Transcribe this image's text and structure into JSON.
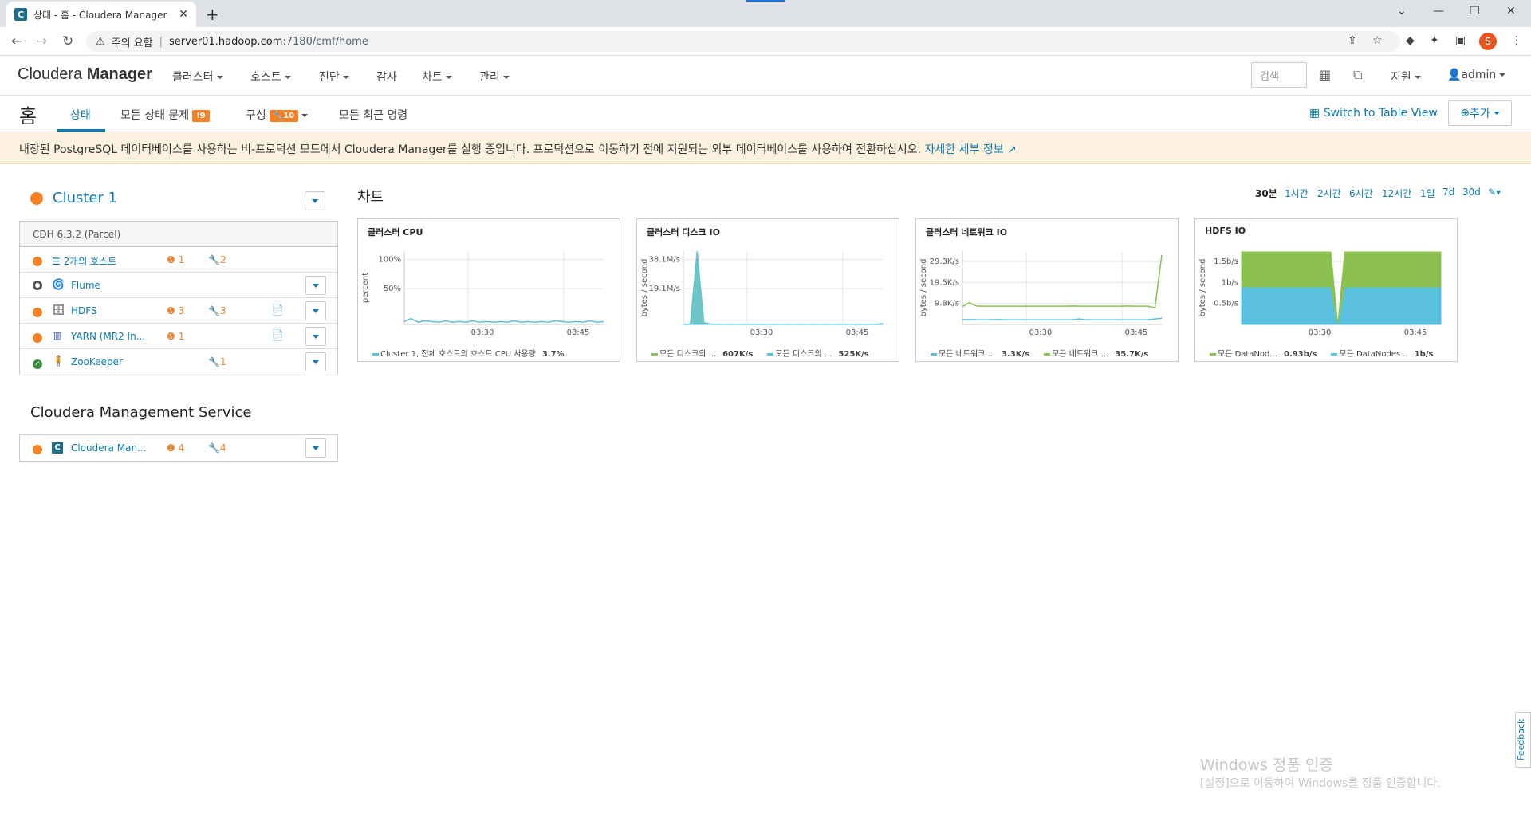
{
  "browser": {
    "tab_title": "상태 - 홈 - Cloudera Manager",
    "security_label": "주의 요함",
    "url_host": "server01.hadoop.com",
    "url_path": ":7180/cmf/home",
    "profile_initial": "S"
  },
  "header": {
    "logo_light": "Cloudera ",
    "logo_bold": "Manager",
    "menu": [
      "클러스터",
      "호스트",
      "진단",
      "감사",
      "차트",
      "관리"
    ],
    "search_placeholder": "검색",
    "support": "지원",
    "user": "admin"
  },
  "subnav": {
    "page_title": "홈",
    "tabs": {
      "status": "상태",
      "all_issues": "모든 상태 문제",
      "all_issues_count": "9",
      "config": "구성",
      "config_count": "10",
      "recent_commands": "모든 최근 명령"
    },
    "table_view": "Switch to Table View",
    "add": "추가"
  },
  "banner": {
    "text": "내장된 PostgreSQL 데이터베이스를 사용하는 비-프로덕션 모드에서 Cloudera Manager를 실행 중입니다. 프로덕션으로 이동하기 전에 지원되는 외부 데이터베이스를 사용하여 전환하십시오.",
    "link": "자세한 세부 정보"
  },
  "cluster": {
    "name": "Cluster 1",
    "version": "CDH 6.3.2 (Parcel)",
    "rows": [
      {
        "name": "2개의 호스트",
        "alerts": "1",
        "config": "2"
      },
      {
        "name": "Flume",
        "alerts": "",
        "config": ""
      },
      {
        "name": "HDFS",
        "alerts": "3",
        "config": "3"
      },
      {
        "name": "YARN (MR2 In...",
        "alerts": "1",
        "config": ""
      },
      {
        "name": "ZooKeeper",
        "alerts": "",
        "config": "1"
      }
    ]
  },
  "mgmt": {
    "title": "Cloudera Management Service",
    "row": {
      "name": "Cloudera Man...",
      "alerts": "4",
      "config": "4"
    }
  },
  "charts": {
    "title": "차트",
    "ranges": [
      "30분",
      "1시간",
      "2시간",
      "6시간",
      "12시간",
      "1일",
      "7d",
      "30d"
    ],
    "active_range": "30분"
  },
  "chart_data": [
    {
      "type": "line",
      "title": "클러스터 CPU",
      "ylabel": "percent",
      "yticks": [
        "100%",
        "50%"
      ],
      "xticks": [
        "03:30",
        "03:45"
      ],
      "ylim": [
        0,
        100
      ],
      "series": [
        {
          "name": "Cluster 1, 전체 호스트의 호스트 CPU 사용량",
          "last": "3.7%",
          "color": "#5bc0de",
          "values": [
            4,
            8,
            3,
            5,
            4,
            3,
            5,
            3,
            4,
            3,
            5,
            3,
            4,
            3,
            4,
            3,
            5,
            3,
            4,
            3,
            4,
            3,
            5,
            4,
            3,
            4,
            3,
            5,
            3,
            4
          ]
        }
      ]
    },
    {
      "type": "area",
      "title": "클러스터 디스크 IO",
      "ylabel": "bytes / second",
      "yticks": [
        "38.1M/s",
        "19.1M/s"
      ],
      "xticks": [
        "03:30",
        "03:45"
      ],
      "ylim": [
        0,
        57
      ],
      "series": [
        {
          "name": "모든 디스크의 ...",
          "last": "607K/s",
          "color": "#8cc152",
          "values": [
            0.3,
            0.5,
            57,
            1.5,
            0.5,
            0.4,
            0.3,
            0.4,
            0.3,
            0.4,
            0.3,
            0.4,
            0.3,
            0.4,
            0.3,
            0.4,
            0.3,
            0.4,
            0.3,
            0.4,
            0.3,
            0.4,
            0.3,
            0.4,
            0.3,
            0.4,
            0.3,
            0.4,
            0.3,
            0.6
          ]
        },
        {
          "name": "모든 디스크의 ...",
          "last": "525K/s",
          "color": "#5bc0de",
          "values": [
            0.2,
            0.3,
            57,
            1.2,
            0.3,
            0.2,
            0.2,
            0.2,
            0.2,
            0.2,
            0.2,
            0.2,
            0.2,
            0.2,
            0.2,
            0.2,
            0.2,
            0.2,
            0.2,
            0.2,
            0.2,
            0.2,
            0.2,
            0.2,
            0.2,
            0.2,
            0.2,
            0.2,
            0.2,
            0.5
          ]
        }
      ]
    },
    {
      "type": "line",
      "title": "클러스터 네트워크 IO",
      "ylabel": "bytes / second",
      "yticks": [
        "29.3K/s",
        "19.5K/s",
        "9.8K/s"
      ],
      "xticks": [
        "03:30",
        "03:45"
      ],
      "ylim": [
        0,
        39
      ],
      "series": [
        {
          "name": "모든 네트워크 ...",
          "last": "3.3K/s",
          "color": "#5bc0de",
          "values": [
            2.5,
            2.6,
            2.5,
            2.5,
            2.5,
            2.6,
            2.5,
            2.5,
            2.5,
            2.5,
            2.5,
            2.5,
            2.5,
            2.5,
            2.5,
            2.5,
            2.5,
            2.9,
            2.5,
            2.5,
            2.5,
            2.5,
            2.5,
            2.5,
            2.5,
            2.5,
            2.5,
            2.5,
            2.9,
            3.3
          ]
        },
        {
          "name": "모든 네트워크 ...",
          "last": "35.7K/s",
          "color": "#8cc152",
          "values": [
            9.5,
            11.5,
            9.8,
            9.7,
            9.7,
            9.7,
            9.7,
            9.7,
            9.7,
            9.7,
            9.7,
            9.7,
            9.7,
            9.7,
            9.7,
            9.7,
            9.8,
            9.7,
            9.7,
            9.7,
            9.7,
            9.7,
            9.7,
            9.7,
            9.8,
            9.7,
            9.7,
            9.7,
            8.8,
            37
          ]
        }
      ]
    },
    {
      "type": "area",
      "title": "HDFS IO",
      "ylabel": "bytes / second",
      "yticks": [
        "1.5b/s",
        "1b/s",
        "0.5b/s"
      ],
      "xticks": [
        "03:30",
        "03:45"
      ],
      "ylim": [
        0,
        1.95
      ],
      "stacked": true,
      "series": [
        {
          "name": "모든 DataNodes...",
          "last": "1b/s",
          "color": "#5bc0de",
          "values": [
            1,
            1,
            1,
            1,
            1,
            1,
            1,
            1,
            1,
            1,
            1,
            1,
            1,
            1,
            0,
            1,
            1,
            1,
            1,
            1,
            1,
            1,
            1,
            1,
            1,
            1,
            1,
            1,
            1,
            1
          ]
        },
        {
          "name": "모든 DataNod...",
          "last": "0.93b/s",
          "color": "#8cc152",
          "values": [
            0.93,
            0.93,
            0.93,
            0.93,
            0.93,
            0.93,
            0.93,
            0.93,
            0.93,
            0.93,
            0.93,
            0.93,
            0.93,
            0.93,
            0,
            0.93,
            0.93,
            0.93,
            0.93,
            0.93,
            0.93,
            0.93,
            0.93,
            0.93,
            0.93,
            0.93,
            0.93,
            0.93,
            0.93,
            0.93
          ]
        }
      ]
    }
  ],
  "watermark": {
    "line1": "Windows 정품 인증",
    "line2": "[설정]으로 이동하여 Windows를 정품 인증합니다."
  },
  "feedback": "Feedback",
  "colors": {
    "accent": "#0a7bb3",
    "warning": "#f58025",
    "ok": "#3c8d40"
  }
}
